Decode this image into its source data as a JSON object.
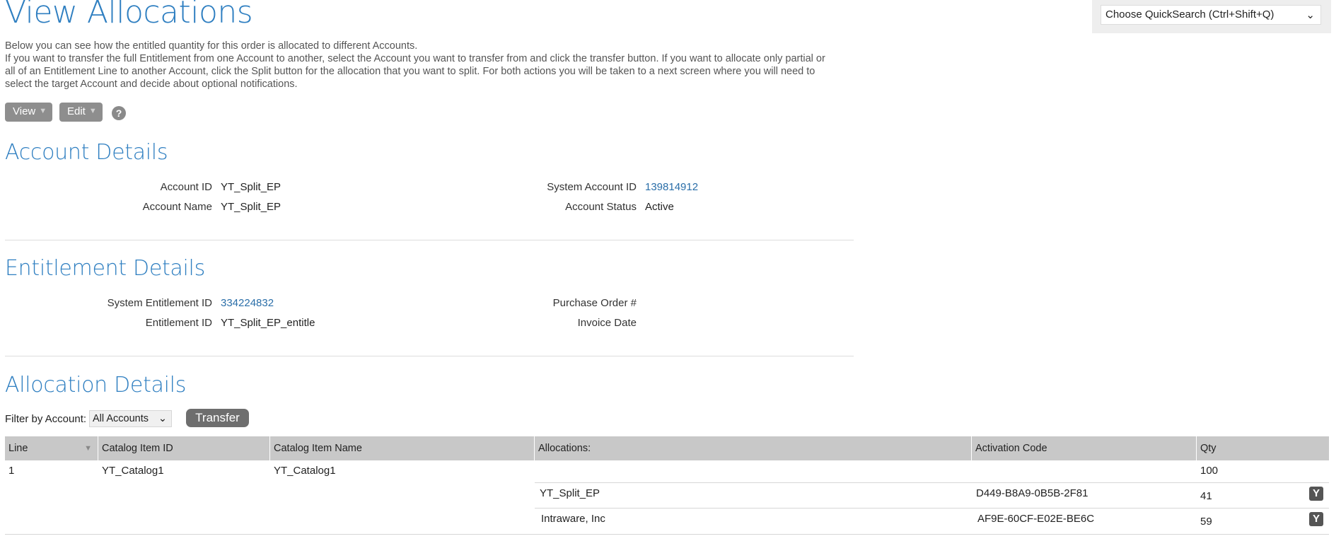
{
  "page": {
    "title": "View Allocations"
  },
  "quicksearch": {
    "selected": "Choose QuickSearch (Ctrl+Shift+Q)"
  },
  "intro": {
    "line1": "Below you can see how the entitled quantity for this order is allocated to different Accounts.",
    "line2": "If you want to transfer the full Entitlement from one Account to another, select the Account you want to transfer from and click the transfer button. If you want to allocate only partial or all of an Entitlement Line to another Account, click the Split button for the allocation that you want to split. For both actions you will be taken to a next screen where you will need to select the target Account and decide about optional notifications."
  },
  "toolbar": {
    "view_label": "View",
    "edit_label": "Edit",
    "help_label": "?"
  },
  "account_details": {
    "title": "Account Details",
    "account_id_label": "Account ID",
    "account_id": "YT_Split_EP",
    "account_name_label": "Account Name",
    "account_name": "YT_Split_EP",
    "system_account_id_label": "System Account ID",
    "system_account_id": "139814912",
    "account_status_label": "Account Status",
    "account_status": "Active"
  },
  "entitlement_details": {
    "title": "Entitlement Details",
    "system_entitlement_id_label": "System Entitlement ID",
    "system_entitlement_id": "334224832",
    "entitlement_id_label": "Entitlement ID",
    "entitlement_id": "YT_Split_EP_entitle",
    "purchase_order_label": "Purchase Order #",
    "purchase_order": "",
    "invoice_date_label": "Invoice Date",
    "invoice_date": ""
  },
  "allocation_details": {
    "title": "Allocation Details",
    "filter_label": "Filter by Account:",
    "filter_selected": "All Accounts",
    "transfer_label": "Transfer",
    "columns": {
      "line": "Line",
      "catalog_item_id": "Catalog Item ID",
      "catalog_item_name": "Catalog Item Name",
      "allocations": "Allocations:",
      "activation_code": "Activation Code",
      "qty": "Qty"
    },
    "rows": [
      {
        "line": "1",
        "catalog_item_id": "YT_Catalog1",
        "catalog_item_name": "YT_Catalog1",
        "qty": "100",
        "allocations": [
          {
            "account": "YT_Split_EP",
            "activation_code": "D449-B8A9-0B5B-2F81",
            "qty": "41",
            "action_icon": "split-icon"
          },
          {
            "account": "Intraware, Inc",
            "activation_code": "AF9E-60CF-E02E-BE6C",
            "qty": "59",
            "action_icon": "split-icon"
          }
        ]
      }
    ]
  },
  "colors": {
    "accent": "#2f7fc1",
    "link": "#2a6ea8",
    "visited_link": "#7a2a8a",
    "header_bg": "#c8c8c8"
  }
}
